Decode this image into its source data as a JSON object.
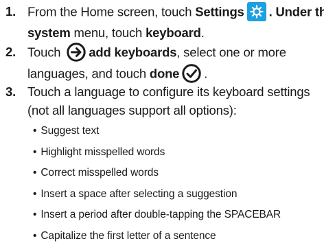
{
  "steps": [
    {
      "number": "1.",
      "line1": {
        "pre": "From the Home screen, touch ",
        "bold1": "Settings",
        "post": ". Under the"
      },
      "line2": {
        "bold1": "system",
        "mid": " menu, touch ",
        "bold2": "keyboard",
        "post": "."
      }
    },
    {
      "number": "2.",
      "line1": {
        "pre": "Touch ",
        "bold1": "add keyboards",
        "post": ", select one or more"
      },
      "line2": {
        "pre": "languages, and touch ",
        "bold1": "done",
        "post": "."
      }
    },
    {
      "number": "3.",
      "line1": "Touch a language to configure its keyboard settings",
      "line2": "(not all languages support all options):"
    }
  ],
  "options": [
    "Suggest text",
    "Highlight misspelled words",
    "Correct misspelled words",
    "Insert a space after selecting a suggestion",
    "Insert a period after double-tapping the SPACEBAR",
    "Capitalize the first letter of a sentence"
  ],
  "icons": {
    "settings": "settings-gear-icon",
    "add": "add-arrow-icon",
    "done": "done-check-icon"
  },
  "colors": {
    "settings_tile": "#1ba1e2",
    "icon_dark": "#1a1a1a"
  }
}
